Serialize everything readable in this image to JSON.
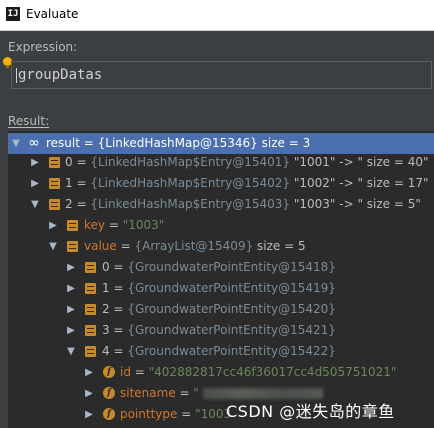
{
  "window": {
    "title": "Evaluate"
  },
  "expression": {
    "label": "Expression:",
    "value": "groupDatas"
  },
  "result": {
    "label": "Result:"
  },
  "tree": {
    "root": {
      "name": "result",
      "eq": " = ",
      "ref": "{LinkedHashMap@15346}",
      "extra": "  size = 3"
    },
    "entries": [
      {
        "name": "0",
        "eq": " = ",
        "ref": "{LinkedHashMap$Entry@15401}",
        "extra": " \"1001\" -> \" size = 40\""
      },
      {
        "name": "1",
        "eq": " = ",
        "ref": "{LinkedHashMap$Entry@15402}",
        "extra": " \"1002\" -> \" size = 17\""
      },
      {
        "name": "2",
        "eq": " = ",
        "ref": "{LinkedHashMap$Entry@15403}",
        "extra": " \"1003\" -> \" size = 5\""
      }
    ],
    "key": {
      "name": "key",
      "eq": " = ",
      "value": "\"1003\""
    },
    "value": {
      "name": "value",
      "eq": " = ",
      "ref": "{ArrayList@15409}",
      "extra": "  size = 5"
    },
    "items": [
      {
        "name": "0",
        "eq": " = ",
        "ref": "{GroundwaterPointEntity@15418}"
      },
      {
        "name": "1",
        "eq": " = ",
        "ref": "{GroundwaterPointEntity@15419}"
      },
      {
        "name": "2",
        "eq": " = ",
        "ref": "{GroundwaterPointEntity@15420}"
      },
      {
        "name": "3",
        "eq": " = ",
        "ref": "{GroundwaterPointEntity@15421}"
      },
      {
        "name": "4",
        "eq": " = ",
        "ref": "{GroundwaterPointEntity@15422}"
      }
    ],
    "fields": [
      {
        "name": "id",
        "eq": " = ",
        "value": "\"402882817cc46f36017cc4d505751021\""
      },
      {
        "name": "sitename",
        "eq": " = ",
        "value": "\""
      },
      {
        "name": "pointtype",
        "eq": " = ",
        "value": "\"1003"
      }
    ]
  },
  "watermark": "CSDN @迷失岛的章鱼"
}
